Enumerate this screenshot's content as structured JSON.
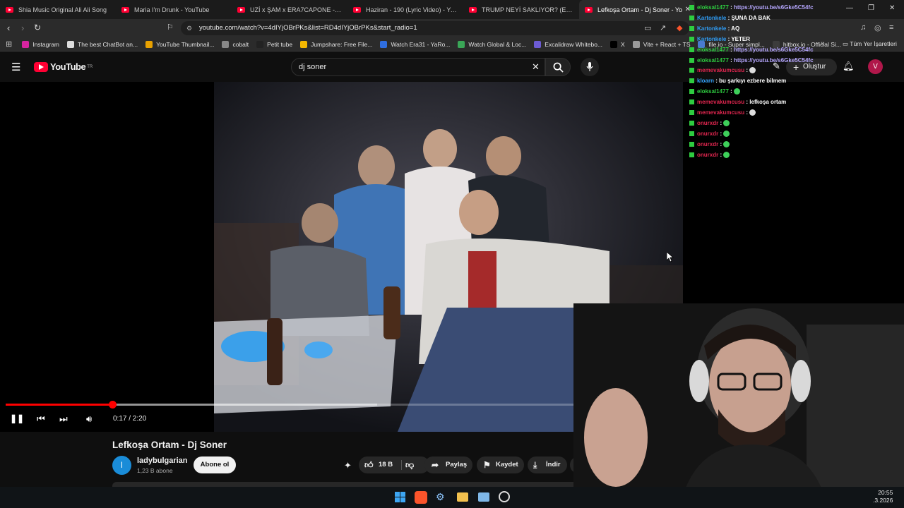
{
  "browser": {
    "tabs": [
      {
        "title": "Shia Music Original Ali Ali Song",
        "active": false
      },
      {
        "title": "Maria I'm Drunk - YouTube",
        "active": false
      },
      {
        "title": "UZİ x ŞAM x ERA7CAPONE - HASTAN",
        "active": false
      },
      {
        "title": "Haziran - 190 (Lyric Video) - YouTube",
        "active": false
      },
      {
        "title": "TRUMP NEYİ SAKLIYOR? (Epstein) - Y",
        "active": false
      },
      {
        "title": "Lefkoşa Ortam - Dj Soner - Yo",
        "active": true
      }
    ],
    "url": "youtube.com/watch?v=4dIYjOBrPKs&list=RD4dIYjOBrPKs&start_radio=1",
    "bookmarks": [
      {
        "label": "Instagram",
        "color": "#d6249f"
      },
      {
        "label": "The best ChatBot an...",
        "color": "#dddddd"
      },
      {
        "label": "YouTube Thumbnail...",
        "color": "#e8a100"
      },
      {
        "label": "cobalt",
        "color": "#888888"
      },
      {
        "label": "Petit tube",
        "color": "#222222"
      },
      {
        "label": "Jumpshare: Free File...",
        "color": "#f2b600"
      },
      {
        "label": "Watch Era31 - YaRo...",
        "color": "#2f6ee0"
      },
      {
        "label": "Watch Global & Loc...",
        "color": "#3aa657"
      },
      {
        "label": "Excalidraw Whitebo...",
        "color": "#6c5bd4"
      },
      {
        "label": "X",
        "color": "#000000"
      },
      {
        "label": "Vite + React + TS",
        "color": "#9a9a9a"
      },
      {
        "label": "file.io - Super simpl...",
        "color": "#4a7bd1"
      },
      {
        "label": "hitbox.io - Official Si...",
        "color": "#3c3c3c"
      }
    ],
    "bookmarks_more": "»",
    "all_bookmarks": "Tüm Yer İşaretleri"
  },
  "youtube": {
    "logo": "YouTube",
    "region": "TR",
    "search_query": "dj soner",
    "create_label": "Oluştur",
    "avatar_letter": "V"
  },
  "player": {
    "current_time": "0:17",
    "duration": "2:20",
    "time_display": "0:17 / 2:20",
    "progress_fraction": 0.121,
    "buffer_fraction": 0.42
  },
  "video": {
    "title": "Lefkoşa Ortam - Dj Soner",
    "channel": "ladybulgarian",
    "channel_initial": "l",
    "subscribers": "1,23 B abone",
    "subscribe_label": "Abone ol",
    "likes": "18 B",
    "share_label": "Paylaş",
    "save_label": "Kaydet",
    "download_label": "İndir"
  },
  "chat": [
    {
      "user": "eloksal1477",
      "color": "#2ecc40",
      "message": "https://youtu.be/s6Gke5C54fc",
      "link": true
    },
    {
      "user": "Kartonkele",
      "color": "#2f9cf4",
      "message": "ŞUNA DA BAK",
      "link": false
    },
    {
      "user": "Kartonkele",
      "color": "#2f9cf4",
      "message": "AQ",
      "link": false
    },
    {
      "user": "Kartonkele",
      "color": "#2f9cf4",
      "message": "YETER",
      "link": false
    },
    {
      "user": "eloksal1477",
      "color": "#2ecc40",
      "message": "https://youtu.be/s6Gke5C54fc",
      "link": true
    },
    {
      "user": "eloksal1477",
      "color": "#2ecc40",
      "message": "https://youtu.be/s6Gke5C54fc",
      "link": true
    },
    {
      "user": "memevakumcusu",
      "color": "#e0264f",
      "message": "",
      "emote": "#dddddd"
    },
    {
      "user": "kloarn",
      "color": "#2f9cf4",
      "message": "bu şarkıyı ezbere bilmem",
      "link": false
    },
    {
      "user": "eloksal1477",
      "color": "#2ecc40",
      "message": "",
      "emote": "#3ecf5a"
    },
    {
      "user": "memevakumcusu",
      "color": "#e0264f",
      "message": "lefkoşa ortam",
      "link": false
    },
    {
      "user": "memevakumcusu",
      "color": "#e0264f",
      "message": "",
      "emote": "#dddddd"
    },
    {
      "user": "onurxdr",
      "color": "#e0264f",
      "message": "",
      "emote": "#3ecf5a"
    },
    {
      "user": "onurxdr",
      "color": "#e0264f",
      "message": "",
      "emote": "#3ecf5a"
    },
    {
      "user": "onurxdr",
      "color": "#e0264f",
      "message": "",
      "emote": "#3ecf5a"
    },
    {
      "user": "onurxdr",
      "color": "#e0264f",
      "message": "",
      "emote": "#3ecf5a"
    }
  ],
  "taskbar": {
    "time": "20:55",
    "date": ".3.2026"
  }
}
